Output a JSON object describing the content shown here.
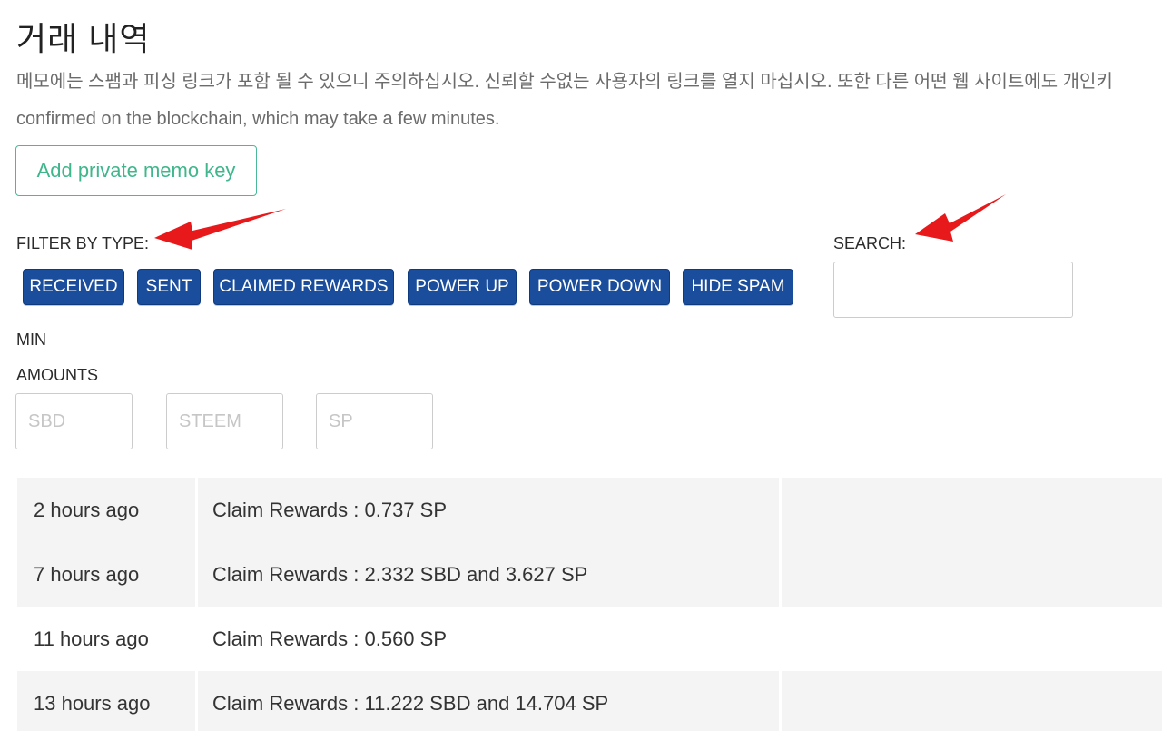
{
  "page": {
    "title": "거래 내역",
    "notice_line1": "메모에는 스팸과 피싱 링크가 포함 될 수 있으니 주의하십시오. 신뢰할 수없는 사용자의 링크를 열지 마십시오. 또한 다른 어떤 웹 사이트에도 개인키",
    "notice_line2": "confirmed on the blockchain, which may take a few minutes."
  },
  "memo": {
    "add_key_label": "Add private memo key"
  },
  "filter": {
    "label": "FILTER BY TYPE:",
    "buttons": [
      "RECEIVED",
      "SENT",
      "CLAIMED REWARDS",
      "POWER UP",
      "POWER DOWN",
      "HIDE SPAM"
    ]
  },
  "search": {
    "label": "SEARCH:",
    "value": ""
  },
  "min_amounts": {
    "label_line1": "MIN",
    "label_line2": "AMOUNTS",
    "placeholders": [
      "SBD",
      "STEEM",
      "SP"
    ]
  },
  "transactions": [
    {
      "time": "2 hours ago",
      "description": "Claim Rewards : 0.737 SP",
      "extra": ""
    },
    {
      "time": "7 hours ago",
      "description": "Claim Rewards : 2.332 SBD and 3.627 SP",
      "extra": ""
    },
    {
      "time": "11 hours ago",
      "description": "Claim Rewards : 0.560 SP",
      "extra": ""
    },
    {
      "time": "13 hours ago",
      "description": "Claim Rewards : 11.222 SBD and 14.704 SP",
      "extra": ""
    }
  ],
  "colors": {
    "filter_button_bg": "#1a4d9b",
    "memo_button_accent": "#3fb68b",
    "annotation_arrow": "#e8191b",
    "row_shade": "#f4f4f4"
  },
  "annotations": {
    "arrow_icon": "red-arrow-icon"
  }
}
